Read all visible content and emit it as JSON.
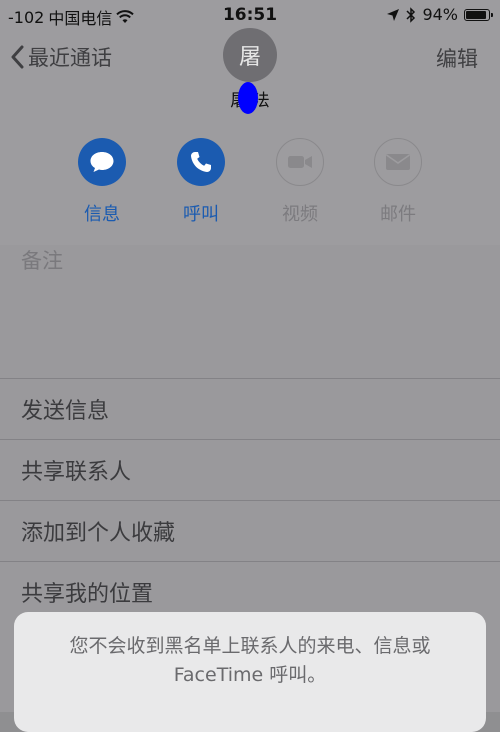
{
  "status_bar": {
    "signal": "-102",
    "carrier": "中国电信",
    "time": "16:51",
    "battery_percent": "94%",
    "battery_level": 0.94
  },
  "nav": {
    "back_label": "最近通话",
    "edit_label": "编辑"
  },
  "contact": {
    "avatar_text": "屠",
    "name": "屠 法"
  },
  "actions": [
    {
      "label": "信息",
      "icon": "message-icon",
      "enabled": true
    },
    {
      "label": "呼叫",
      "icon": "phone-icon",
      "enabled": true
    },
    {
      "label": "视频",
      "icon": "video-icon",
      "enabled": false
    },
    {
      "label": "邮件",
      "icon": "mail-icon",
      "enabled": false
    }
  ],
  "notes_label": "备注",
  "menu_items": [
    {
      "label": "发送信息"
    },
    {
      "label": "共享联系人"
    },
    {
      "label": "添加到个人收藏"
    },
    {
      "label": "共享我的位置"
    }
  ],
  "alert": {
    "message": "您不会收到黑名单上联系人的来电、信息或 FaceTime 呼叫。"
  },
  "colors": {
    "accent": "#1b5bb0",
    "redaction": "#0000ff"
  }
}
